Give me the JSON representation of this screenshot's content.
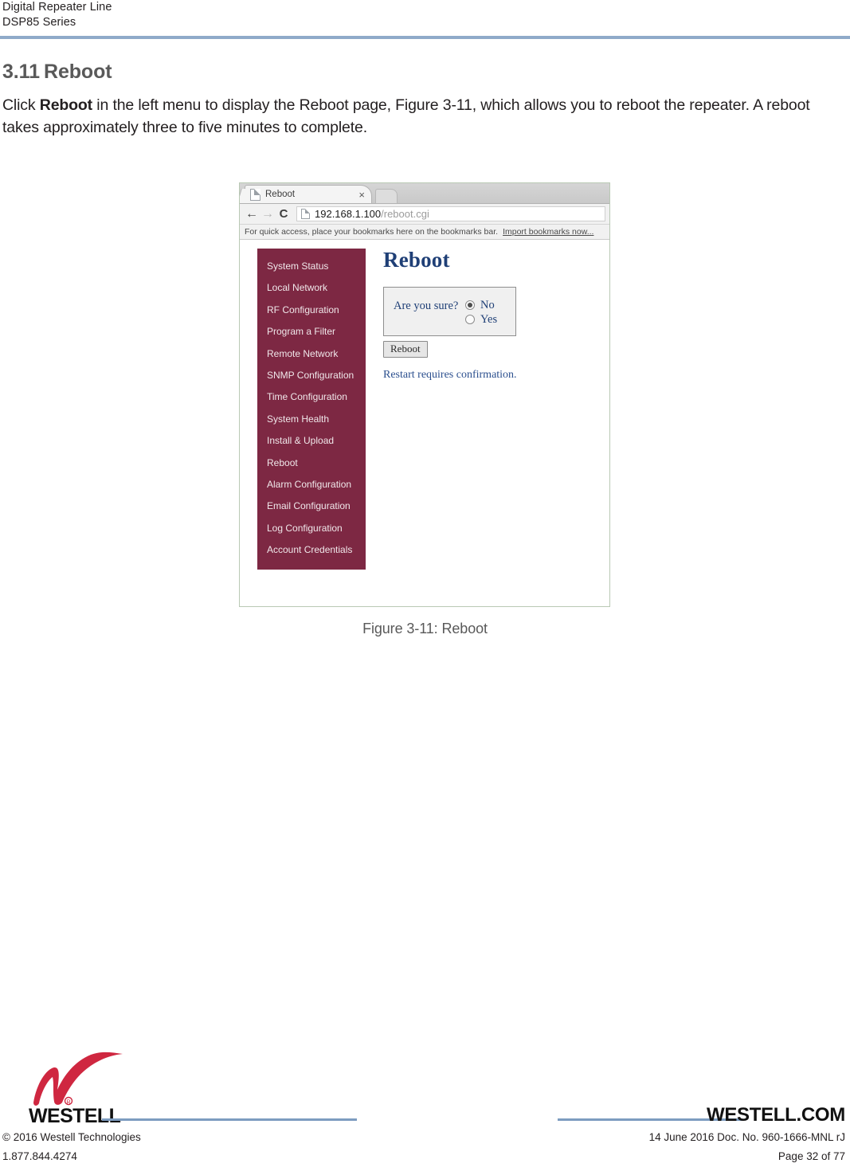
{
  "header": {
    "line1": "Digital Repeater Line",
    "line2": "DSP85 Series",
    "rule_color": "#8faac9"
  },
  "section": {
    "number": "3.11",
    "title": "Reboot"
  },
  "paragraph": {
    "part1": "Click ",
    "bold": "Reboot",
    "part2": " in the left menu to display the Reboot page, Figure 3-11, which allows you to reboot the repeater.  A reboot takes approximately three to five minutes to complete."
  },
  "figure": {
    "caption": "Figure 3-11: Reboot",
    "browser": {
      "tab": {
        "title": "Reboot",
        "close_label": "×",
        "favicon": "page-icon"
      },
      "toolbar": {
        "back": "←",
        "forward": "→",
        "reload": "C",
        "url_host": "192.168.1.100",
        "url_path": "/reboot.cgi"
      },
      "bookmarks": {
        "text": "For quick access, place your bookmarks here on the bookmarks bar.",
        "link": "Import bookmarks now..."
      }
    },
    "sidebar": {
      "background": "#7d2843",
      "items": [
        "System Status",
        "Local Network",
        "RF Configuration",
        "Program a Filter",
        "Remote Network",
        "SNMP Configuration",
        "Time Configuration",
        "System Health",
        "Install & Upload",
        "Reboot",
        "Alarm Configuration",
        "Email Configuration",
        "Log Configuration",
        "Account Credentials"
      ]
    },
    "content": {
      "title": "Reboot",
      "title_color": "#1f3f76",
      "confirm_label": "Are you sure?",
      "options": [
        {
          "label": "No",
          "selected": true
        },
        {
          "label": "Yes",
          "selected": false
        }
      ],
      "submit_label": "Reboot",
      "note": "Restart requires confirmation."
    }
  },
  "footer": {
    "logo_word": "WESTELL",
    "site": "WESTELL.COM",
    "left_line1": "© 2016 Westell Technologies",
    "left_line2": "1.877.844.4274",
    "right_line1": "14 June 2016 Doc. No. 960-1666-MNL rJ",
    "right_line2": "Page 32 of 77",
    "rule_color": "#7d9cc0",
    "logo_color": "#cf2740"
  }
}
